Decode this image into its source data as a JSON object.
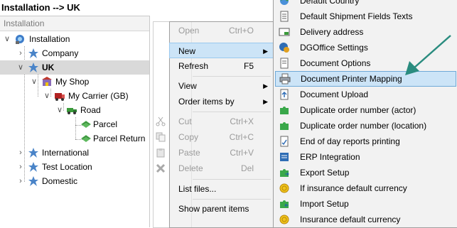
{
  "breadcrumb": "Installation --> UK",
  "tree_header": "Installation",
  "tree": [
    {
      "label": "Installation",
      "icon": "network-icon"
    },
    {
      "label": "Company",
      "icon": "sites-icon"
    },
    {
      "label": "UK",
      "icon": "sites-icon"
    },
    {
      "label": "My Shop",
      "icon": "shop-icon"
    },
    {
      "label": "My Carrier (GB)",
      "icon": "carrier-icon"
    },
    {
      "label": "Road",
      "icon": "truck-icon"
    },
    {
      "label": "Parcel",
      "icon": "parcel-icon"
    },
    {
      "label": "Parcel Return",
      "icon": "parcel-icon"
    },
    {
      "label": "International",
      "icon": "sites-icon"
    },
    {
      "label": "Test Location",
      "icon": "sites-icon"
    },
    {
      "label": "Domestic",
      "icon": "sites-icon"
    }
  ],
  "context_menu": {
    "open": {
      "label": "Open",
      "shortcut": "Ctrl+O"
    },
    "new": {
      "label": "New"
    },
    "refresh": {
      "label": "Refresh",
      "shortcut": "F5"
    },
    "view": {
      "label": "View"
    },
    "order_items_by": {
      "label": "Order items by"
    },
    "cut": {
      "label": "Cut",
      "shortcut": "Ctrl+X"
    },
    "copy": {
      "label": "Copy",
      "shortcut": "Ctrl+C"
    },
    "paste": {
      "label": "Paste",
      "shortcut": "Ctrl+V"
    },
    "delete": {
      "label": "Delete",
      "shortcut": "Del"
    },
    "list_files": {
      "label": "List files..."
    },
    "show_parent_items": {
      "label": "Show parent items"
    }
  },
  "submenu": [
    {
      "label": "Default Country",
      "icon": "globe-icon"
    },
    {
      "label": "Default Shipment Fields Texts",
      "icon": "document-icon"
    },
    {
      "label": "Delivery address",
      "icon": "address-card-icon"
    },
    {
      "label": "DGOffice Settings",
      "icon": "settings-globe-icon"
    },
    {
      "label": "Document Options",
      "icon": "document-icon"
    },
    {
      "label": "Document Printer Mapping",
      "icon": "printer-icon"
    },
    {
      "label": "Document Upload",
      "icon": "document-upload-icon"
    },
    {
      "label": "Duplicate order number (actor)",
      "icon": "puzzle-icon"
    },
    {
      "label": "Duplicate order number (location)",
      "icon": "puzzle-icon"
    },
    {
      "label": "End of day reports printing",
      "icon": "report-icon"
    },
    {
      "label": "ERP Integration",
      "icon": "erp-icon"
    },
    {
      "label": "Export Setup",
      "icon": "export-icon"
    },
    {
      "label": "If insurance default currency",
      "icon": "coin-icon"
    },
    {
      "label": "Import Setup",
      "icon": "import-icon"
    },
    {
      "label": "Insurance default currency",
      "icon": "coin-icon"
    }
  ],
  "highlight": {
    "submenu_index": 5,
    "accent": "#2a8c7f"
  },
  "colors": {
    "highlight_bg": "#cce4f7",
    "highlight_border": "#99c9ef",
    "selected_row": "#d9d9d9"
  }
}
